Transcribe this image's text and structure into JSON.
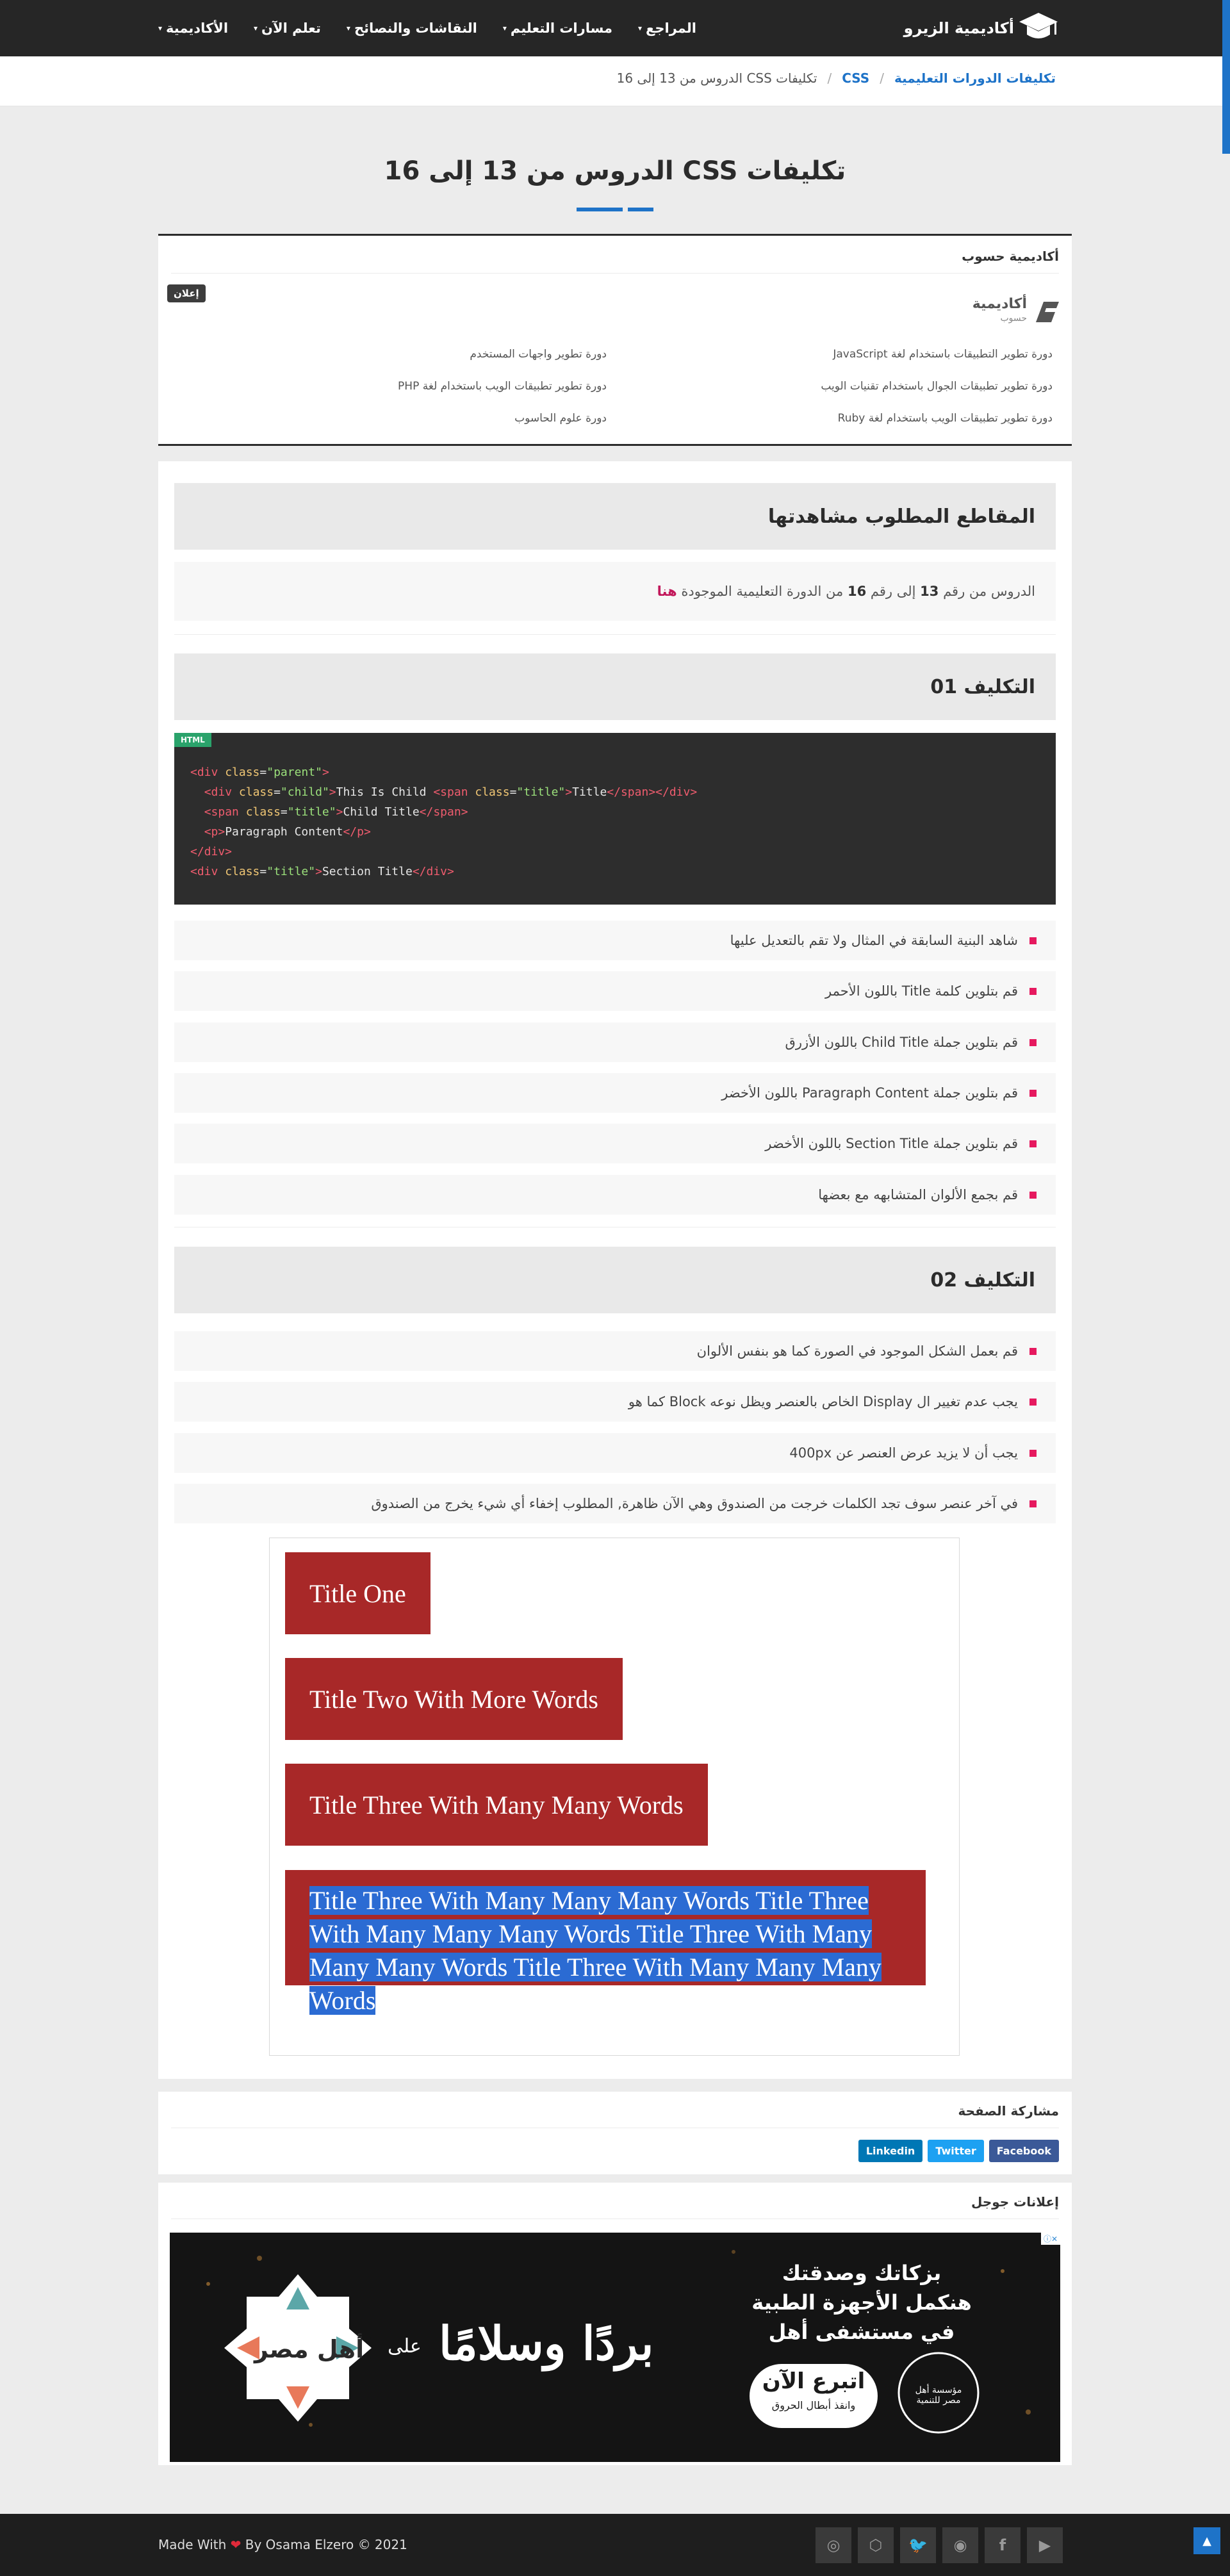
{
  "brand": {
    "name": "أكاديمية الزيرو"
  },
  "nav": {
    "items": [
      {
        "label": "الأكاديمية"
      },
      {
        "label": "تعلم الآن"
      },
      {
        "label": "النقاشات والنصائح"
      },
      {
        "label": "مسارات التعليم"
      },
      {
        "label": "المراجع"
      }
    ]
  },
  "breadcrumb": {
    "root": "تكليفات الدورات التعليمية",
    "section": "CSS",
    "current": "تكليفات CSS الدروس من 13 إلى 16"
  },
  "page": {
    "title": "تكليفات CSS الدروس من 13 إلى 16"
  },
  "ad": {
    "heading": "أكاديمية حسوب",
    "badge": "إعلان",
    "logo_text": "أكاديمية",
    "logo_sub": "حسوب",
    "links_right": [
      "دورة تطوير التطبيقات باستخدام لغة JavaScript",
      "دورة تطوير تطبيقات الجوال باستخدام تقنيات الويب",
      "دورة تطوير تطبيقات الويب باستخدام لغة Ruby"
    ],
    "links_left": [
      "دورة تطوير واجهات المستخدم",
      "دورة تطوير تطبيقات الويب باستخدام لغة PHP",
      "دورة علوم الحاسوب"
    ]
  },
  "videos": {
    "heading": "المقاطع المطلوب مشاهدتها",
    "text_prefix": "الدروس من رقم",
    "from": "13",
    "mid": "إلى رقم",
    "to": "16",
    "text_suffix": "من الدورة التعليمية الموجودة",
    "link": "هنا"
  },
  "task1": {
    "heading": "التكليف 01",
    "code_lang": "HTML",
    "items": [
      "شاهد البنية السابقة في المثال ولا تقم بالتعديل عليها",
      "قم بتلوين كلمة Title باللون الأحمر",
      "قم بتلوين جملة Child Title باللون الأزرق",
      "قم بتلوين جملة Paragraph Content باللون الأخضر",
      "قم بتلوين جملة Section Title باللون الأخضر",
      "قم بجمع الألوان المتشابهه مع بعضها"
    ]
  },
  "task2": {
    "heading": "التكليف 02",
    "items": [
      "قم بعمل الشكل الموجود في الصورة كما هو بنفس الألوان",
      "يجب عدم تغيير ال Display الخاص بالعنصر ويظل نوعه Block كما هو",
      "يجب أن لا يزيد عرض العنصر عن 400px",
      "في آخر عنصر سوف تجد الكلمات خرجت من الصندوق وهي الآن ظاهرة, المطلوب إخفاء أي شيء يخرج من الصندوق"
    ],
    "demo_titles": [
      "Title One",
      "Title Two With More Words",
      "Title Three With Many Many Words",
      "Title Three With Many Many Many Words Title Three With Many Many Many Words Title Three With Many Many Many Words Title Three With Many Many Many Words"
    ]
  },
  "share": {
    "heading": "مشاركة الصفحة",
    "buttons": [
      {
        "label": "Facebook",
        "color": "#3b5998"
      },
      {
        "label": "Twitter",
        "color": "#1da1f2"
      },
      {
        "label": "Linkedin",
        "color": "#0077b5"
      }
    ]
  },
  "google_ads": {
    "heading": "إعلانات جوجل",
    "banner_lines": [
      "بزكاتك وصدقتك",
      "هنكمل الأجهزة الطبية",
      "في مستشفى أهل"
    ],
    "banner_cta": "اتبرع الآن",
    "banner_cta_sub": "وانقذ أبطال الحروق",
    "banner_slogan": "بردًا وسلامًا",
    "banner_on": "على",
    "banner_brand": "أهل مصر",
    "banner_small": "مؤسسة أهل مصر للتنمية",
    "adchoices": "ⓘ✕"
  },
  "footer": {
    "made_with": "Made With",
    "by": "By Osama Elzero © 2021",
    "socials": [
      "youtube-icon",
      "facebook-icon",
      "github-icon",
      "twitter-icon",
      "codepen-icon",
      "instagram-icon"
    ]
  }
}
